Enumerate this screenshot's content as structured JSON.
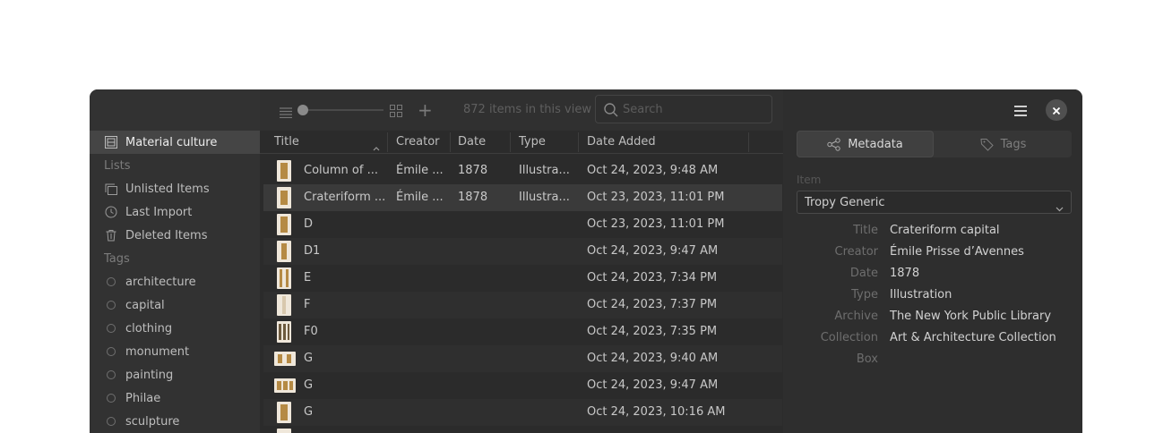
{
  "sidebar": {
    "project": "Material culture",
    "lists_heading": "Lists",
    "lists": [
      "Unlisted Items",
      "Last Import",
      "Deleted Items"
    ],
    "tags_heading": "Tags",
    "tags": [
      "architecture",
      "capital",
      "clothing",
      "monument",
      "painting",
      "Philae",
      "sculpture"
    ]
  },
  "toolbar": {
    "item_count": "872 items in this view",
    "search_placeholder": "Search"
  },
  "table": {
    "columns": [
      "Title",
      "Creator",
      "Date",
      "Type",
      "Date Added"
    ],
    "rows": [
      {
        "title": "Column of ...",
        "creator": "Émile ...",
        "date": "1878",
        "type": "Illustra...",
        "added": "Oct 24, 2023, 9:48 AM"
      },
      {
        "title": "Crateriform ...",
        "creator": "Émile ...",
        "date": "1878",
        "type": "Illustra...",
        "added": "Oct 23, 2023, 11:01 PM"
      },
      {
        "title": "D",
        "creator": "",
        "date": "",
        "type": "",
        "added": "Oct 23, 2023, 11:01 PM"
      },
      {
        "title": "D1",
        "creator": "",
        "date": "",
        "type": "",
        "added": "Oct 24, 2023, 9:47 AM"
      },
      {
        "title": "E",
        "creator": "",
        "date": "",
        "type": "",
        "added": "Oct 24, 2023, 7:34 PM"
      },
      {
        "title": "F",
        "creator": "",
        "date": "",
        "type": "",
        "added": "Oct 24, 2023, 7:37 PM"
      },
      {
        "title": "F0",
        "creator": "",
        "date": "",
        "type": "",
        "added": "Oct 24, 2023, 7:35 PM"
      },
      {
        "title": "G",
        "creator": "",
        "date": "",
        "type": "",
        "added": "Oct 24, 2023, 9:40 AM"
      },
      {
        "title": "G",
        "creator": "",
        "date": "",
        "type": "",
        "added": "Oct 24, 2023, 9:47 AM"
      },
      {
        "title": "G",
        "creator": "",
        "date": "",
        "type": "",
        "added": "Oct 24, 2023, 10:16 AM"
      }
    ]
  },
  "panel": {
    "tabs": [
      "Metadata",
      "Tags"
    ],
    "item_heading": "Item",
    "template": "Tropy Generic",
    "fields": [
      {
        "label": "Title",
        "value": "Crateriform capital"
      },
      {
        "label": "Creator",
        "value": "Émile Prisse d’Avennes"
      },
      {
        "label": "Date",
        "value": "1878"
      },
      {
        "label": "Type",
        "value": "Illustration"
      },
      {
        "label": "Archive",
        "value": "The New York Public Library"
      },
      {
        "label": "Collection",
        "value": "Art & Architecture Collection"
      },
      {
        "label": "Box",
        "value": ""
      }
    ]
  },
  "colors": {
    "window_bg": "#2b2b2b",
    "sidebar_bg": "#323232",
    "selection": "#454545",
    "thumb": "#b58a44"
  }
}
